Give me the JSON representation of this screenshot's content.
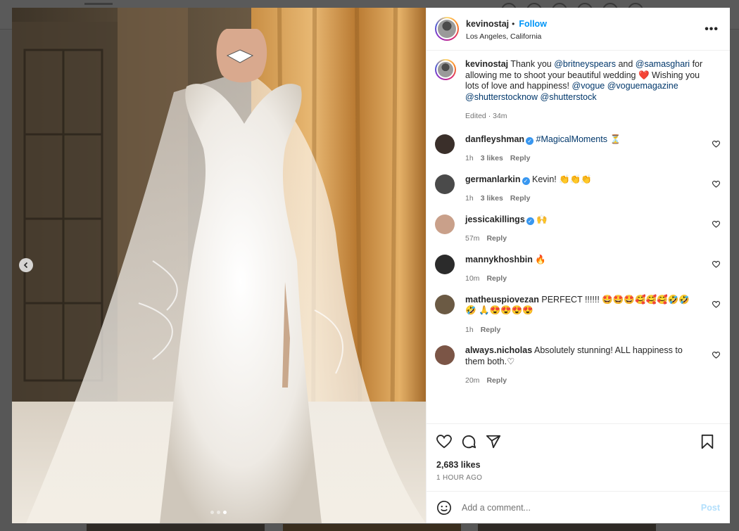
{
  "background": {
    "nav_icons": [
      "explore-icon",
      "messenger-icon",
      "new-post-icon",
      "activity-icon",
      "heart-icon",
      "profile-icon"
    ]
  },
  "photo": {
    "dots": 3,
    "active_dot": 3,
    "description_icon": "chevron-left-icon"
  },
  "post": {
    "username": "kevinostaj",
    "separator": "•",
    "follow_label": "Follow",
    "location": "Los Angeles, California",
    "more_label": "•••"
  },
  "caption": {
    "username": "kevinostaj",
    "t1": "Thank you ",
    "m1": "@britneyspears",
    "t2": " and ",
    "m2": "@samasghari",
    "t3": " for allowing me to shoot your beautiful wedding ",
    "heart": "❤️",
    "t4": " Wishing you lots of love and happiness! ",
    "m3": "@vogue",
    "t5": " ",
    "m4": "@voguemagazine",
    "t6": " ",
    "m5": "@shutterstocknow",
    "t7": " ",
    "m6": "@shutterstock",
    "edited": "Edited · 34m"
  },
  "comments": [
    {
      "user": "danfleyshman",
      "verified": true,
      "text": "",
      "tag": "#MagicalMoments",
      "emoji": " ⏳",
      "time": "1h",
      "likes": "3 likes",
      "reply": "Reply",
      "avatar_color": "#3a2f2a"
    },
    {
      "user": "germanlarkin",
      "verified": true,
      "text": "Kevin! ",
      "tag": "",
      "emoji": "👏👏👏",
      "time": "1h",
      "likes": "3 likes",
      "reply": "Reply",
      "avatar_color": "#4a4a4a"
    },
    {
      "user": "jessicakillings",
      "verified": true,
      "text": "",
      "tag": "",
      "emoji": "🙌",
      "time": "57m",
      "likes": "",
      "reply": "Reply",
      "avatar_color": "#c9a08a"
    },
    {
      "user": "mannykhoshbin",
      "verified": false,
      "text": "",
      "tag": "",
      "emoji": "🔥",
      "time": "10m",
      "likes": "",
      "reply": "Reply",
      "avatar_color": "#2b2b2b"
    },
    {
      "user": "matheuspiovezan",
      "verified": false,
      "text": "PERFECT !!!!!! ",
      "tag": "",
      "emoji": "🤩🤩🤩🥰🥰🥰🤣🤣🤣 🙏😍😍😍😍",
      "time": "1h",
      "likes": "",
      "reply": "Reply",
      "avatar_color": "#6b5a44"
    },
    {
      "user": "always.nicholas",
      "verified": false,
      "text": "Absolutely stunning! ALL happiness to them both.",
      "tag": "",
      "emoji": "♡",
      "time": "20m",
      "likes": "",
      "reply": "Reply",
      "avatar_color": "#7b5546"
    }
  ],
  "actions": {
    "icons": [
      "heart-icon",
      "comment-icon",
      "share-icon",
      "bookmark-icon"
    ]
  },
  "likes_count": "2,683 likes",
  "posted_time": "1 HOUR AGO",
  "add_comment": {
    "placeholder": "Add a comment...",
    "post_label": "Post",
    "emoji_icon": "smiley-icon"
  }
}
